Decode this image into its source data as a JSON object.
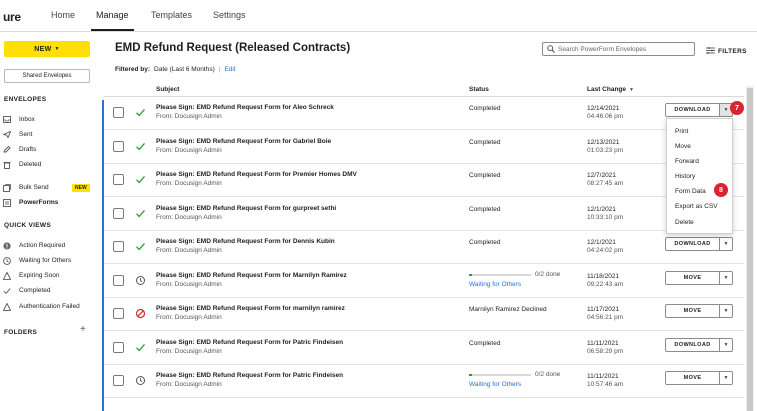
{
  "nav": {
    "logo": "ure",
    "tabs": [
      "Home",
      "Manage",
      "Templates",
      "Settings"
    ]
  },
  "sidebar": {
    "new_label": "NEW",
    "new_caret": "▼",
    "shared_label": "Shared Envelopes",
    "envelopes_title": "ENVELOPES",
    "items": [
      {
        "label": "Inbox",
        "icon": "inbox-icon"
      },
      {
        "label": "Sent",
        "icon": "sent-icon"
      },
      {
        "label": "Drafts",
        "icon": "drafts-icon"
      },
      {
        "label": "Deleted",
        "icon": "trash-icon"
      },
      {
        "label": "Bulk Send",
        "icon": "bulk-send-icon"
      },
      {
        "label": "PowerForms",
        "icon": "powerforms-icon"
      }
    ],
    "bulk_badge": "NEW",
    "quick_views_title": "QUICK VIEWS",
    "quick_views": [
      {
        "label": "Action Required",
        "icon": "action-required-icon"
      },
      {
        "label": "Waiting for Others",
        "icon": "clock-icon"
      },
      {
        "label": "Expiring Soon",
        "icon": "warning-icon"
      },
      {
        "label": "Completed",
        "icon": "check-icon"
      },
      {
        "label": "Authentication Failed",
        "icon": "warning-icon"
      }
    ],
    "folders_title": "FOLDERS",
    "folders_add": "+"
  },
  "main": {
    "title": "EMD Refund Request (Released Contracts)",
    "search_placeholder": "Search PowerForm Envelopes",
    "filters_label": "FILTERS",
    "filtered_by_label": "Filtered by:",
    "filtered_by_value": "Date (Last 6 Months)",
    "edit_label": "Edit",
    "columns": {
      "subject": "Subject",
      "status": "Status",
      "last_change": "Last Change",
      "sort_icon": "▼"
    }
  },
  "rows": [
    {
      "subject": "Please Sign: EMD Refund Request Form for Aleo Schreck",
      "from": "From: Docusign Admin",
      "status": "Completed",
      "date": "12/14/2021",
      "time": "04:46:06 pm",
      "action": "DOWNLOAD",
      "icon": "check"
    },
    {
      "subject": "Please Sign: EMD Refund Request Form for Gabriel Boie",
      "from": "From: Docusign Admin",
      "status": "Completed",
      "date": "12/13/2021",
      "time": "01:03:23 pm",
      "action": "",
      "icon": "check"
    },
    {
      "subject": "Please Sign: EMD Refund Request Form for Premier Homes DMV",
      "from": "From: Docusign Admin",
      "status": "Completed",
      "date": "12/7/2021",
      "time": "08:27:45 am",
      "action": "",
      "icon": "check"
    },
    {
      "subject": "Please Sign: EMD Refund Request Form for gurpreet sethi",
      "from": "From: Docusign Admin",
      "status": "Completed",
      "date": "12/1/2021",
      "time": "10:33:10 pm",
      "action": "",
      "icon": "check"
    },
    {
      "subject": "Please Sign: EMD Refund Request Form for Dennis Kubin",
      "from": "From: Docusign Admin",
      "status": "Completed",
      "date": "12/1/2021",
      "time": "04:24:02 pm",
      "action": "DOWNLOAD",
      "icon": "check"
    },
    {
      "subject": "Please Sign: EMD Refund Request Form for Marnilyn Ramirez",
      "from": "From: Docusign Admin",
      "status": "",
      "progress_label": "0/2 done",
      "progress": 0.05,
      "waiting": "Waiting for Others",
      "date": "11/18/2021",
      "time": "09:22:43 am",
      "action": "MOVE",
      "icon": "clock"
    },
    {
      "subject": "Please Sign: EMD Refund Request Form for marnilyn ramirez",
      "from": "From: Docusign Admin",
      "status": "Marnilyn Ramirez Declined",
      "date": "11/17/2021",
      "time": "04:56:21 pm",
      "action": "MOVE",
      "icon": "declined"
    },
    {
      "subject": "Please Sign: EMD Refund Request Form for Patric Findeisen",
      "from": "From: Docusign Admin",
      "status": "Completed",
      "date": "11/11/2021",
      "time": "06:58:29 pm",
      "action": "DOWNLOAD",
      "icon": "check"
    },
    {
      "subject": "Please Sign: EMD Refund Request Form for Patric Findeisen",
      "from": "From: Docusign Admin",
      "status": "",
      "progress_label": "0/2 done",
      "progress": 0.05,
      "waiting": "Waiting for Others",
      "date": "11/11/2021",
      "time": "10:57:46 am",
      "action": "MOVE",
      "icon": "clock"
    }
  ],
  "menu": {
    "items": [
      "Print",
      "Move",
      "Forward",
      "History",
      "Form Data",
      "Export as CSV",
      "Delete"
    ]
  },
  "callouts": {
    "first": "7",
    "second": "8"
  },
  "colors": {
    "accent": "#2a6fdb",
    "brand_yellow": "#ffe000",
    "success": "#2e9a3f",
    "danger": "#d7262f"
  }
}
